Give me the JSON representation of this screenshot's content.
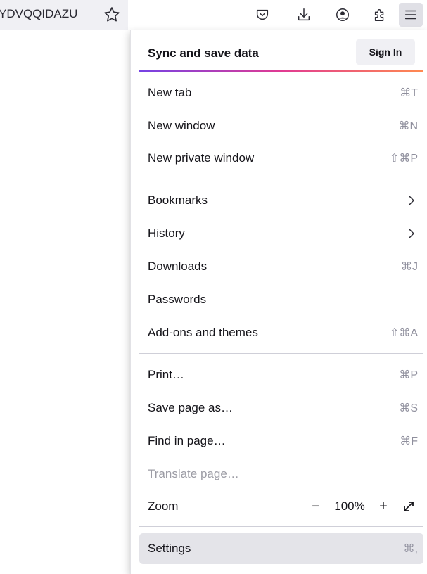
{
  "toolbar": {
    "url_text": "YDVQQIDAZU",
    "bookmark_star_icon": "star-outline-icon",
    "buttons": [
      "pocket-icon",
      "download-icon",
      "account-icon",
      "extensions-icon",
      "hamburger-menu-icon"
    ]
  },
  "menu": {
    "sync": {
      "title": "Sync and save data",
      "signin_label": "Sign In"
    },
    "items": [
      {
        "label": "New tab",
        "shortcut": "⌘T"
      },
      {
        "label": "New window",
        "shortcut": "⌘N"
      },
      {
        "label": "New private window",
        "shortcut": "⇧⌘P"
      },
      {
        "label": "Bookmarks",
        "shortcut": ""
      },
      {
        "label": "History",
        "shortcut": ""
      },
      {
        "label": "Downloads",
        "shortcut": "⌘J"
      },
      {
        "label": "Passwords",
        "shortcut": ""
      },
      {
        "label": "Add-ons and themes",
        "shortcut": "⇧⌘A"
      },
      {
        "label": "Print…",
        "shortcut": "⌘P"
      },
      {
        "label": "Save page as…",
        "shortcut": "⌘S"
      },
      {
        "label": "Find in page…",
        "shortcut": "⌘F"
      },
      {
        "label": "Translate page…",
        "shortcut": ""
      },
      {
        "label": "Zoom",
        "shortcut": ""
      },
      {
        "label": "Settings",
        "shortcut": "⌘,"
      }
    ],
    "zoom": {
      "minus": "−",
      "value": "100%",
      "plus": "+"
    }
  },
  "colors": {
    "accent_gradient": [
      "#7542e5",
      "#e13a92",
      "#ff8a50"
    ],
    "selected_bg": "#e4e4e9",
    "disabled_text": "#9c9ca5",
    "shortcut_text": "#8f8f9d"
  }
}
